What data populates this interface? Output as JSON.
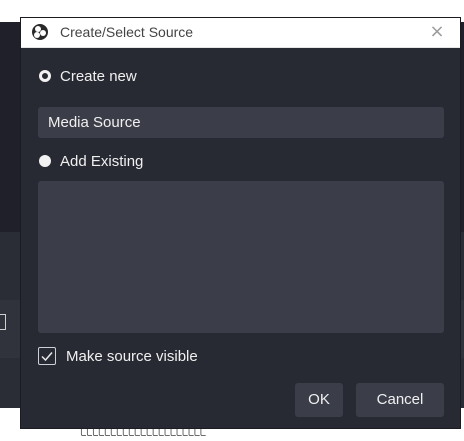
{
  "dialog": {
    "title": "Create/Select Source",
    "close_label": "×",
    "create_new_label": "Create new",
    "name_value": "Media Source",
    "add_existing_label": "Add Existing",
    "make_visible_label": "Make source visible",
    "make_visible_checked": true,
    "ok_label": "OK",
    "cancel_label": "Cancel",
    "selected_option": "Create new"
  },
  "colors": {
    "dialog_bg": "#272a33",
    "field_bg": "#3b3e49",
    "text": "#f0f0f0",
    "titlebar_bg": "#ffffff"
  },
  "icons": {
    "title": "obs-logo-icon",
    "close": "close-icon",
    "check": "checkmark-icon"
  }
}
